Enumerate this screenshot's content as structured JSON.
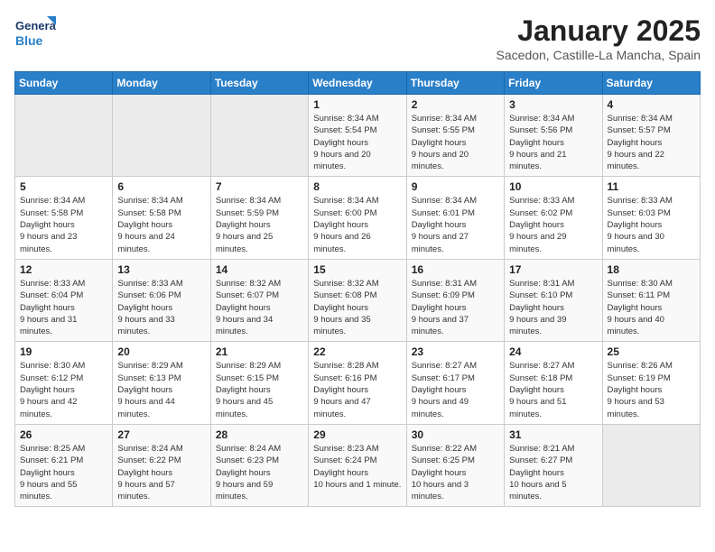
{
  "header": {
    "logo_general": "General",
    "logo_blue": "Blue",
    "month_title": "January 2025",
    "location": "Sacedon, Castille-La Mancha, Spain"
  },
  "weekdays": [
    "Sunday",
    "Monday",
    "Tuesday",
    "Wednesday",
    "Thursday",
    "Friday",
    "Saturday"
  ],
  "weeks": [
    [
      {
        "day": "",
        "empty": true
      },
      {
        "day": "",
        "empty": true
      },
      {
        "day": "",
        "empty": true
      },
      {
        "day": "1",
        "sunrise": "8:34 AM",
        "sunset": "5:54 PM",
        "daylight": "9 hours and 20 minutes."
      },
      {
        "day": "2",
        "sunrise": "8:34 AM",
        "sunset": "5:55 PM",
        "daylight": "9 hours and 20 minutes."
      },
      {
        "day": "3",
        "sunrise": "8:34 AM",
        "sunset": "5:56 PM",
        "daylight": "9 hours and 21 minutes."
      },
      {
        "day": "4",
        "sunrise": "8:34 AM",
        "sunset": "5:57 PM",
        "daylight": "9 hours and 22 minutes."
      }
    ],
    [
      {
        "day": "5",
        "sunrise": "8:34 AM",
        "sunset": "5:58 PM",
        "daylight": "9 hours and 23 minutes."
      },
      {
        "day": "6",
        "sunrise": "8:34 AM",
        "sunset": "5:58 PM",
        "daylight": "9 hours and 24 minutes."
      },
      {
        "day": "7",
        "sunrise": "8:34 AM",
        "sunset": "5:59 PM",
        "daylight": "9 hours and 25 minutes."
      },
      {
        "day": "8",
        "sunrise": "8:34 AM",
        "sunset": "6:00 PM",
        "daylight": "9 hours and 26 minutes."
      },
      {
        "day": "9",
        "sunrise": "8:34 AM",
        "sunset": "6:01 PM",
        "daylight": "9 hours and 27 minutes."
      },
      {
        "day": "10",
        "sunrise": "8:33 AM",
        "sunset": "6:02 PM",
        "daylight": "9 hours and 29 minutes."
      },
      {
        "day": "11",
        "sunrise": "8:33 AM",
        "sunset": "6:03 PM",
        "daylight": "9 hours and 30 minutes."
      }
    ],
    [
      {
        "day": "12",
        "sunrise": "8:33 AM",
        "sunset": "6:04 PM",
        "daylight": "9 hours and 31 minutes."
      },
      {
        "day": "13",
        "sunrise": "8:33 AM",
        "sunset": "6:06 PM",
        "daylight": "9 hours and 33 minutes."
      },
      {
        "day": "14",
        "sunrise": "8:32 AM",
        "sunset": "6:07 PM",
        "daylight": "9 hours and 34 minutes."
      },
      {
        "day": "15",
        "sunrise": "8:32 AM",
        "sunset": "6:08 PM",
        "daylight": "9 hours and 35 minutes."
      },
      {
        "day": "16",
        "sunrise": "8:31 AM",
        "sunset": "6:09 PM",
        "daylight": "9 hours and 37 minutes."
      },
      {
        "day": "17",
        "sunrise": "8:31 AM",
        "sunset": "6:10 PM",
        "daylight": "9 hours and 39 minutes."
      },
      {
        "day": "18",
        "sunrise": "8:30 AM",
        "sunset": "6:11 PM",
        "daylight": "9 hours and 40 minutes."
      }
    ],
    [
      {
        "day": "19",
        "sunrise": "8:30 AM",
        "sunset": "6:12 PM",
        "daylight": "9 hours and 42 minutes."
      },
      {
        "day": "20",
        "sunrise": "8:29 AM",
        "sunset": "6:13 PM",
        "daylight": "9 hours and 44 minutes."
      },
      {
        "day": "21",
        "sunrise": "8:29 AM",
        "sunset": "6:15 PM",
        "daylight": "9 hours and 45 minutes."
      },
      {
        "day": "22",
        "sunrise": "8:28 AM",
        "sunset": "6:16 PM",
        "daylight": "9 hours and 47 minutes."
      },
      {
        "day": "23",
        "sunrise": "8:27 AM",
        "sunset": "6:17 PM",
        "daylight": "9 hours and 49 minutes."
      },
      {
        "day": "24",
        "sunrise": "8:27 AM",
        "sunset": "6:18 PM",
        "daylight": "9 hours and 51 minutes."
      },
      {
        "day": "25",
        "sunrise": "8:26 AM",
        "sunset": "6:19 PM",
        "daylight": "9 hours and 53 minutes."
      }
    ],
    [
      {
        "day": "26",
        "sunrise": "8:25 AM",
        "sunset": "6:21 PM",
        "daylight": "9 hours and 55 minutes."
      },
      {
        "day": "27",
        "sunrise": "8:24 AM",
        "sunset": "6:22 PM",
        "daylight": "9 hours and 57 minutes."
      },
      {
        "day": "28",
        "sunrise": "8:24 AM",
        "sunset": "6:23 PM",
        "daylight": "9 hours and 59 minutes."
      },
      {
        "day": "29",
        "sunrise": "8:23 AM",
        "sunset": "6:24 PM",
        "daylight": "10 hours and 1 minute."
      },
      {
        "day": "30",
        "sunrise": "8:22 AM",
        "sunset": "6:25 PM",
        "daylight": "10 hours and 3 minutes."
      },
      {
        "day": "31",
        "sunrise": "8:21 AM",
        "sunset": "6:27 PM",
        "daylight": "10 hours and 5 minutes."
      },
      {
        "day": "",
        "empty": true
      }
    ]
  ],
  "labels": {
    "sunrise": "Sunrise:",
    "sunset": "Sunset:",
    "daylight": "Daylight hours"
  }
}
